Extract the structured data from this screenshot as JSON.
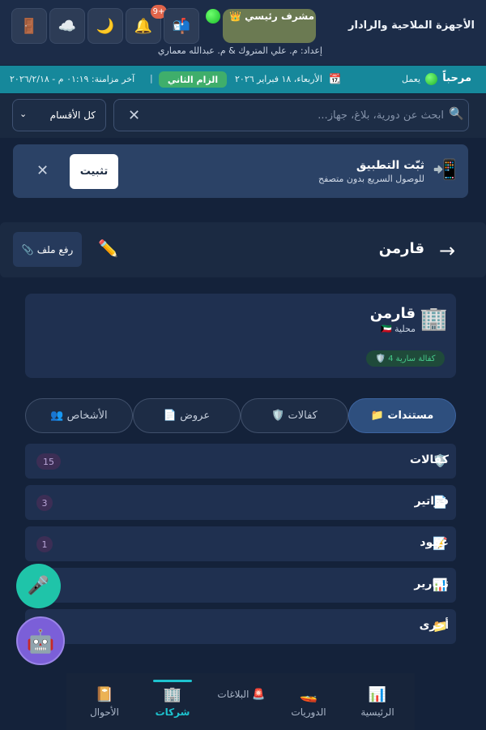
{
  "header": {
    "app_title": "الأجهزة الملاحية والرادار",
    "prepared_by": "إعداد: م. علي المتروك & م. عبدالله معماري",
    "role_label": "👑 مشرف رئيسي",
    "notification_count": "9+",
    "buttons": {
      "exit_icon": "🚪",
      "weather_icon": "☁️",
      "theme_icon": "🌙",
      "bell_icon": "🔔",
      "mail_icon": "📬"
    }
  },
  "status": {
    "welcome": "مرحباً",
    "working": "يعمل",
    "date": "الأربعاء، ١٨ فبراير ٢٠٢٦",
    "team": "الزام الثاني",
    "separator": "|",
    "last_sync": "آخر مزامنة: ٠١:١٩ م - ٢٠٢٦/٢/١٨"
  },
  "search": {
    "placeholder": "ابحث عن دورية، بلاغ، جهاز...",
    "value": "",
    "filter_selected": "كل الأقسام"
  },
  "install": {
    "title": "ثبّت التطبيق",
    "subtitle": "للوصول السريع بدون متصفح",
    "button": "تثبيت"
  },
  "page": {
    "title": "قارمن",
    "upload_label": "رفع ملف"
  },
  "company": {
    "name": "قارمن",
    "type": "🇰🇼 محلية",
    "guarantees_pill": "🛡️ 4 كفالة سارية"
  },
  "tabs": [
    {
      "label": "📁 مستندات",
      "active": true
    },
    {
      "label": "🛡️ كفالات",
      "active": false
    },
    {
      "label": "📄 عروض",
      "active": false
    },
    {
      "label": "👥 الأشخاص",
      "active": false
    }
  ],
  "folders": [
    {
      "icon": "🛡️",
      "label": "كفالات",
      "count": "15"
    },
    {
      "icon": "📄",
      "label": "فواتير",
      "count": "3"
    },
    {
      "icon": "📝",
      "label": "عقود",
      "count": "1"
    },
    {
      "icon": "📊",
      "label": "تقارير",
      "count": ""
    },
    {
      "icon": "📁",
      "label": "أخرى",
      "count": ""
    }
  ],
  "nav": [
    {
      "icon": "📊",
      "label": "الرئيسية",
      "active": false
    },
    {
      "icon": "🚤",
      "label": "الدوريات",
      "active": false
    },
    {
      "icon": "🚨",
      "label": "البلاغات",
      "active": false
    },
    {
      "icon": "🏢",
      "label": "شركات",
      "active": true
    },
    {
      "icon": "📔",
      "label": "الأحوال",
      "active": false
    }
  ],
  "colors": {
    "accent": "#1ec3cf",
    "statusbar": "#16889b",
    "team_badge": "#3fae6b",
    "notification": "#e0644a"
  }
}
